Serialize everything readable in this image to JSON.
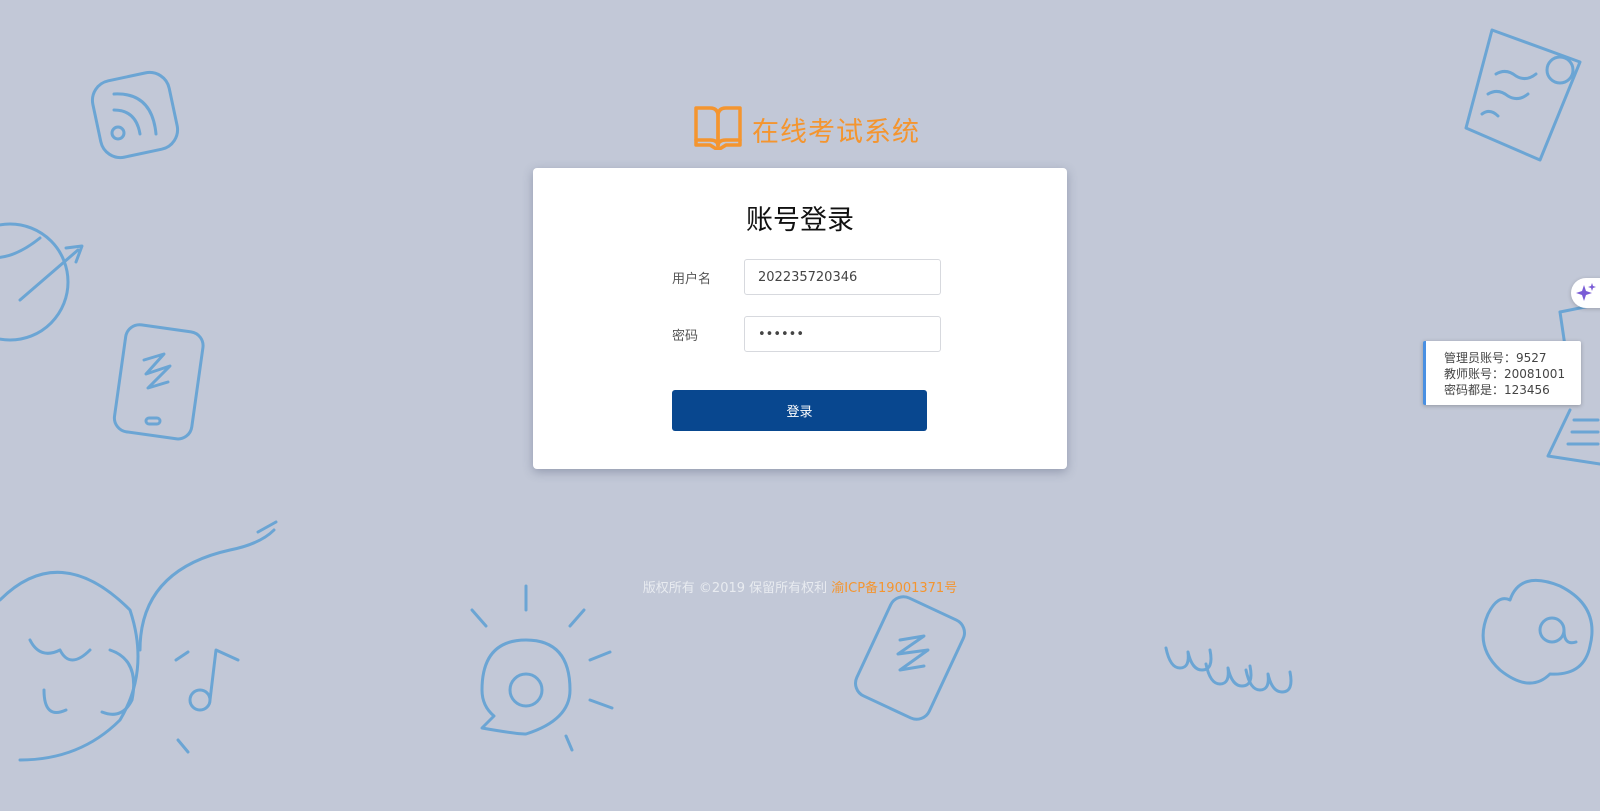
{
  "app": {
    "title": "在线考试系统",
    "logo_icon": "open-book-icon",
    "brand_color": "#f4952f"
  },
  "login": {
    "title": "账号登录",
    "username_label": "用户名",
    "username_value": "202235720346",
    "password_label": "密码",
    "password_value": "••••••",
    "submit_label": "登录",
    "button_color": "#08478f"
  },
  "footer": {
    "copyright": "版权所有 ©2019 保留所有权利 ",
    "icp": "渝ICP备19001371号"
  },
  "hint": {
    "line1": "管理员账号：9527",
    "line2": "教师账号：20081001",
    "line3": "密码都是：123456"
  },
  "assistant": {
    "icon": "sparkle-icon"
  },
  "background": {
    "color": "#c2c8d7",
    "doodle_icons": [
      "rss-icon",
      "document-icon",
      "globe-icon",
      "phone-icon",
      "headphones-icon",
      "music-note-icon",
      "lightbulb-icon",
      "tablet-icon",
      "www-icon",
      "at-sign-icon",
      "laptop-icon"
    ]
  }
}
